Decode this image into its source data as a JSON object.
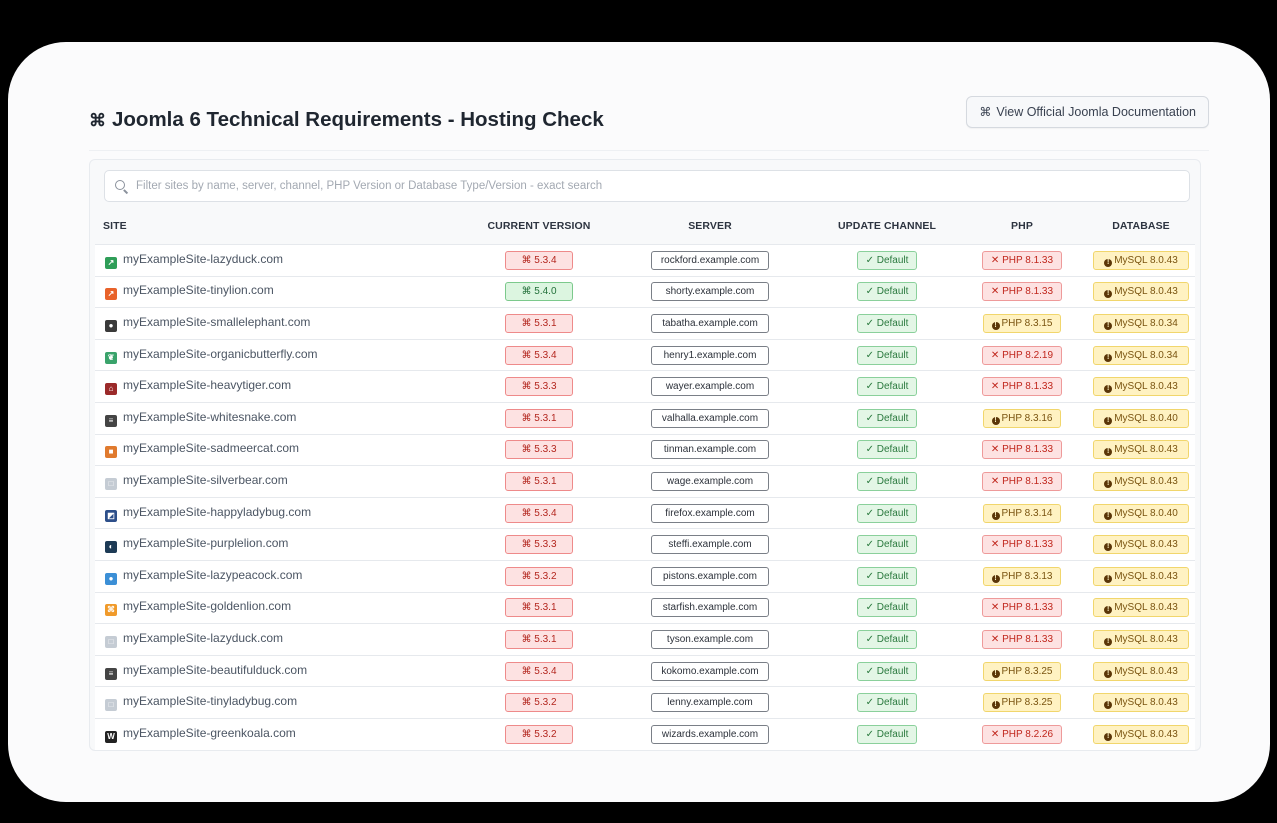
{
  "header": {
    "title": "Joomla 6 Technical Requirements - Hosting Check",
    "title_icon": "joomla-logo-icon",
    "doc_button": "View Official Joomla Documentation"
  },
  "search": {
    "placeholder": "Filter sites by name, server, channel, PHP Version or Database Type/Version - exact search",
    "value": ""
  },
  "columns": [
    "SITE",
    "CURRENT VERSION",
    "SERVER",
    "UPDATE CHANNEL",
    "PHP",
    "DATABASE"
  ],
  "colors": {
    "red_bg": "#fde2e2",
    "green_bg": "#dcf5e0",
    "yellow_bg": "#fff2c2"
  },
  "rows": [
    {
      "site": "myExampleSite-lazyduck.com",
      "favicon": "green-mark-icon",
      "version": "5.3.4",
      "version_status": "red",
      "server": "rockford.example.com",
      "channel": "Default",
      "php": "PHP 8.1.33",
      "php_status": "red",
      "database": "MySQL 8.0.43"
    },
    {
      "site": "myExampleSite-tinylion.com",
      "favicon": "orange-mark-icon",
      "version": "5.4.0",
      "version_status": "green",
      "server": "shorty.example.com",
      "channel": "Default",
      "php": "PHP 8.1.33",
      "php_status": "red",
      "database": "MySQL 8.0.43"
    },
    {
      "site": "myExampleSite-smallelephant.com",
      "favicon": "dark-circle-icon",
      "version": "5.3.1",
      "version_status": "red",
      "server": "tabatha.example.com",
      "channel": "Default",
      "php": "PHP 8.3.15",
      "php_status": "yellow",
      "database": "MySQL 8.0.34"
    },
    {
      "site": "myExampleSite-organicbutterfly.com",
      "favicon": "green-leaf-icon",
      "version": "5.3.4",
      "version_status": "red",
      "server": "henry1.example.com",
      "channel": "Default",
      "php": "PHP 8.2.19",
      "php_status": "red",
      "database": "MySQL 8.0.34"
    },
    {
      "site": "myExampleSite-heavytiger.com",
      "favicon": "red-house-icon",
      "version": "5.3.3",
      "version_status": "red",
      "server": "wayer.example.com",
      "channel": "Default",
      "php": "PHP 8.1.33",
      "php_status": "red",
      "database": "MySQL 8.0.43"
    },
    {
      "site": "myExampleSite-whitesnake.com",
      "favicon": "text-logo-icon",
      "version": "5.3.1",
      "version_status": "red",
      "server": "valhalla.example.com",
      "channel": "Default",
      "php": "PHP 8.3.16",
      "php_status": "yellow",
      "database": "MySQL 8.0.40"
    },
    {
      "site": "myExampleSite-sadmeercat.com",
      "favicon": "orange-box-icon",
      "version": "5.3.3",
      "version_status": "red",
      "server": "tinman.example.com",
      "channel": "Default",
      "php": "PHP 8.1.33",
      "php_status": "red",
      "database": "MySQL 8.0.43"
    },
    {
      "site": "myExampleSite-silverbear.com",
      "favicon": "image-placeholder-icon",
      "version": "5.3.1",
      "version_status": "red",
      "server": "wage.example.com",
      "channel": "Default",
      "php": "PHP 8.1.33",
      "php_status": "red",
      "database": "MySQL 8.0.43"
    },
    {
      "site": "myExampleSite-happyladybug.com",
      "favicon": "blue-photo-icon",
      "version": "5.3.4",
      "version_status": "red",
      "server": "firefox.example.com",
      "channel": "Default",
      "php": "PHP 8.3.14",
      "php_status": "yellow",
      "database": "MySQL 8.0.40"
    },
    {
      "site": "myExampleSite-purplelion.com",
      "favicon": "dark-photo-icon",
      "version": "5.3.3",
      "version_status": "red",
      "server": "steffi.example.com",
      "channel": "Default",
      "php": "PHP 8.1.33",
      "php_status": "red",
      "database": "MySQL 8.0.43"
    },
    {
      "site": "myExampleSite-lazypeacock.com",
      "favicon": "water-drop-icon",
      "version": "5.3.2",
      "version_status": "red",
      "server": "pistons.example.com",
      "channel": "Default",
      "php": "PHP 8.3.13",
      "php_status": "yellow",
      "database": "MySQL 8.0.43"
    },
    {
      "site": "myExampleSite-goldenlion.com",
      "favicon": "joomla-logo-icon",
      "version": "5.3.1",
      "version_status": "red",
      "server": "starfish.example.com",
      "channel": "Default",
      "php": "PHP 8.1.33",
      "php_status": "red",
      "database": "MySQL 8.0.43"
    },
    {
      "site": "myExampleSite-lazyduck.com",
      "favicon": "image-placeholder-icon",
      "version": "5.3.1",
      "version_status": "red",
      "server": "tyson.example.com",
      "channel": "Default",
      "php": "PHP 8.1.33",
      "php_status": "red",
      "database": "MySQL 8.0.43"
    },
    {
      "site": "myExampleSite-beautifulduck.com",
      "favicon": "text-logo-icon",
      "version": "5.3.4",
      "version_status": "red",
      "server": "kokomo.example.com",
      "channel": "Default",
      "php": "PHP 8.3.25",
      "php_status": "yellow",
      "database": "MySQL 8.0.43"
    },
    {
      "site": "myExampleSite-tinyladybug.com",
      "favicon": "image-placeholder-icon",
      "version": "5.3.2",
      "version_status": "red",
      "server": "lenny.example.com",
      "channel": "Default",
      "php": "PHP 8.3.25",
      "php_status": "yellow",
      "database": "MySQL 8.0.43"
    },
    {
      "site": "myExampleSite-greenkoala.com",
      "favicon": "w-logo-icon",
      "version": "5.3.2",
      "version_status": "red",
      "server": "wizards.example.com",
      "channel": "Default",
      "php": "PHP 8.2.26",
      "php_status": "red",
      "database": "MySQL 8.0.43"
    }
  ]
}
